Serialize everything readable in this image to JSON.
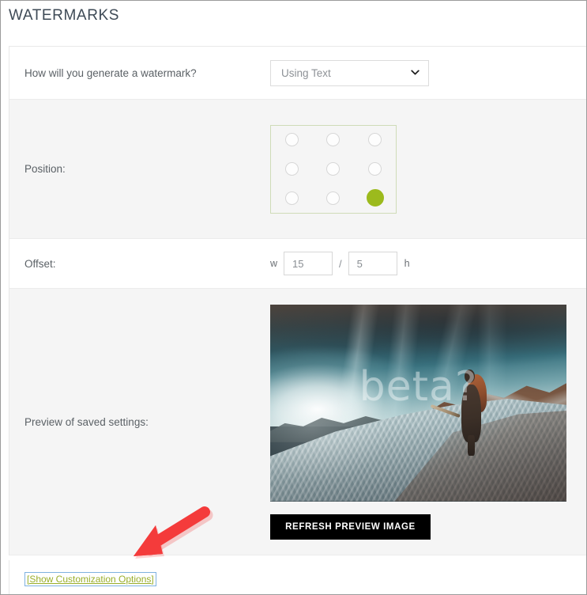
{
  "page": {
    "title": "WATERMARKS"
  },
  "rows": {
    "generate": {
      "label": "How will you generate a watermark?",
      "select": {
        "value": "Using Text",
        "caret_icon": "chevron-down-icon"
      }
    },
    "position": {
      "label": "Position:",
      "selected_index": 8,
      "options": [
        "top-left",
        "top-center",
        "top-right",
        "middle-left",
        "middle-center",
        "middle-right",
        "bottom-left",
        "bottom-center",
        "bottom-right"
      ],
      "selected_color": "#9cba1d",
      "box_border_color": "#cfdcb8"
    },
    "offset": {
      "label": "Offset:",
      "width_unit": "w",
      "width_value": "15",
      "separator": "/",
      "height_value": "5",
      "height_unit": "h"
    },
    "preview": {
      "label": "Preview of saved settings:",
      "image_alt": "hiker-on-snowy-ridge-photo",
      "image_watermark_text": "beta?",
      "refresh_button": "REFRESH PREVIEW IMAGE"
    }
  },
  "footer": {
    "customization_link": "[Show Customization Options]",
    "link_color": "#9aae2a"
  },
  "annotation": {
    "arrow_color": "#f43b3b",
    "arrow_points_to": "customization-link"
  }
}
